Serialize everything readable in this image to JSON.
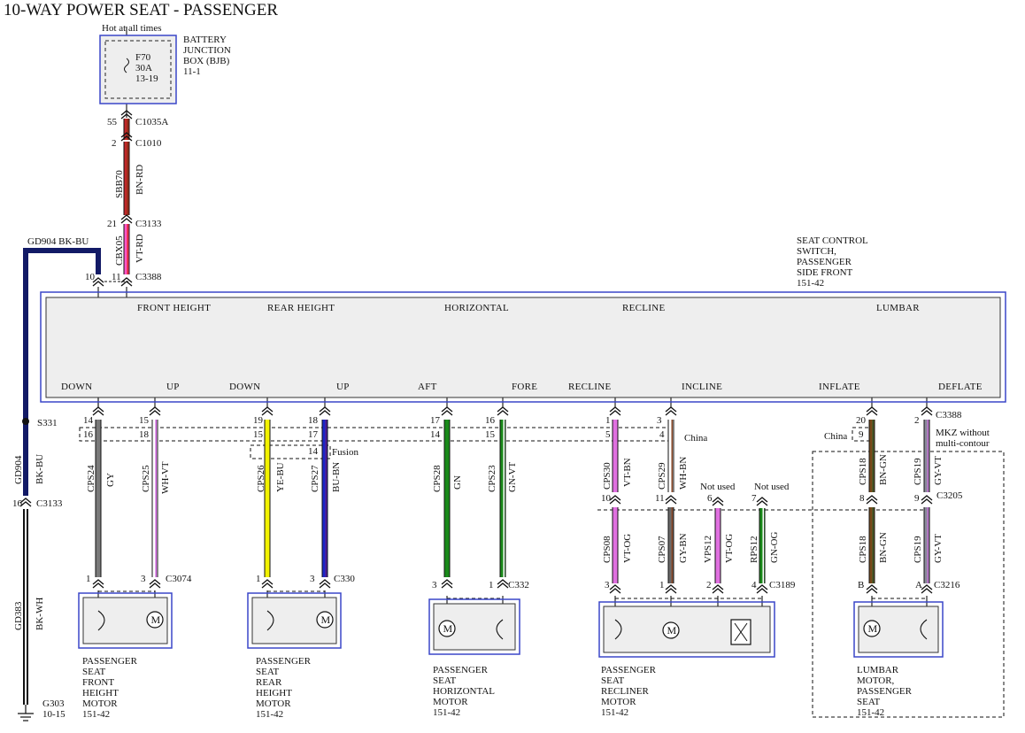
{
  "title": "10-WAY POWER SEAT - PASSENGER",
  "battery": {
    "hot": "Hot at all times",
    "name_lines": [
      "BATTERY",
      "JUNCTION",
      "BOX (BJB)",
      "11-1"
    ],
    "fuse_lines": [
      "F70",
      "30A",
      "13-19"
    ]
  },
  "feed": {
    "c1035a_pin": "55",
    "c1035a": "C1035A",
    "c1010_pin": "2",
    "c1010": "C1010",
    "sbb70_circuit": "SBB70",
    "sbb70_color": "BN-RD",
    "c3133_pin": "21",
    "c3133": "C3133",
    "cbx05_circuit": "CBX05",
    "cbx05_color": "VT-RD",
    "c3388_pin": "11",
    "c3388": "C3388"
  },
  "ground": {
    "gd904_label": "GD904  BK-BU",
    "gd904_circuit": "GD904",
    "gd904_color": "BK-BU",
    "switch_pin": "10",
    "s331": "S331",
    "c3133_pin": "16",
    "c3133": "C3133",
    "gd383_circuit": "GD383",
    "gd383_color": "BK-WH",
    "g303_lines": [
      "G303",
      "10-15"
    ]
  },
  "switch": {
    "name_lines": [
      "SEAT CONTROL",
      "SWITCH,",
      "PASSENGER",
      "SIDE FRONT",
      "151-42"
    ],
    "functions": [
      "FRONT HEIGHT",
      "REAR HEIGHT",
      "HORIZONTAL",
      "RECLINE",
      "LUMBAR"
    ],
    "positions": [
      "DOWN",
      "UP",
      "DOWN",
      "UP",
      "AFT",
      "FORE",
      "RECLINE",
      "INCLINE",
      "INFLATE",
      "DEFLATE"
    ],
    "connector": "C3388"
  },
  "wires": [
    {
      "pin": "14",
      "alt_pin": "16",
      "circuit": "CPS24",
      "color": "GY",
      "mpin": "1"
    },
    {
      "pin": "15",
      "alt_pin": "18",
      "circuit": "CPS25",
      "color": "WH-VT",
      "mpin": "3"
    },
    {
      "pin": "19",
      "alt_pin": "15",
      "circuit": "CPS26",
      "color": "YE-BU",
      "mpin": "1"
    },
    {
      "pin": "18",
      "alt_pin": "17",
      "fusion_pin": "14",
      "circuit": "CPS27",
      "color": "BU-BN",
      "mpin": "3"
    },
    {
      "pin": "17",
      "alt_pin": "14",
      "circuit": "CPS28",
      "color": "GN",
      "mpin": "3"
    },
    {
      "pin": "16",
      "alt_pin": "15",
      "circuit": "CPS23",
      "color": "GN-VT",
      "mpin": "1"
    },
    {
      "pin": "1",
      "alt_pin": "5",
      "circuit": "CPS30",
      "color": "VT-BN",
      "mid_pin": "10",
      "circuit2": "CPS08",
      "color2": "VT-OG",
      "mpin": "3"
    },
    {
      "pin": "3",
      "alt_pin": "4",
      "circuit": "CPS29",
      "color": "WH-BN",
      "mid_pin": "11",
      "circuit2": "CPS07",
      "color2": "GY-BN",
      "mpin": "1"
    },
    {
      "pin": "20",
      "alt_pin": "9",
      "circuit": "CPS18",
      "color": "BN-GN",
      "mid_pin": "8",
      "circuit2": "CPS18",
      "color2": "BN-GN",
      "mpin": "B"
    },
    {
      "pin": "2",
      "circuit": "CPS19",
      "color": "GY-VT",
      "mid_pin": "9",
      "circuit2": "CPS19",
      "color2": "GY-VT",
      "mpin": "A"
    }
  ],
  "recliner_extra": [
    {
      "label": "Not used",
      "pin": "6",
      "circuit": "VPS12",
      "color": "VT-OG",
      "mpin": "2"
    },
    {
      "label": "Not used",
      "pin": "7",
      "circuit": "RPS12",
      "color": "GN-OG",
      "mpin": "4"
    }
  ],
  "notes": {
    "china": "China",
    "fusion": "Fusion",
    "mkz": "MKZ without",
    "mkz2": "multi-contour",
    "c3205": "C3205"
  },
  "motor_connectors": [
    "C3074",
    "C330",
    "C332",
    "C3189",
    "C3216"
  ],
  "motors": [
    [
      "PASSENGER",
      "SEAT",
      "FRONT",
      "HEIGHT",
      "MOTOR",
      "151-42"
    ],
    [
      "PASSENGER",
      "SEAT",
      "REAR",
      "HEIGHT",
      "MOTOR",
      "151-42"
    ],
    [
      "PASSENGER",
      "SEAT",
      "HORIZONTAL",
      "MOTOR",
      "151-42"
    ],
    [
      "PASSENGER",
      "SEAT",
      "RECLINER",
      "MOTOR",
      "151-42"
    ],
    [
      "LUMBAR",
      "MOTOR,",
      "PASSENGER",
      "SEAT",
      "151-42"
    ]
  ],
  "motor_symbol": "M",
  "colors": {
    "BN-RD": [
      "#c0282a",
      "#8b2e14"
    ],
    "VT-RD": [
      "#ff55c8",
      "#e0282a"
    ],
    "BK-BU": [
      "#121a66",
      "#121a66"
    ],
    "BK-WH": [
      "#111111",
      "#ffffff"
    ],
    "GY": [
      "#7a7a7a",
      "#7a7a7a"
    ],
    "WH-VT": [
      "#ffffff",
      "#c55ad6"
    ],
    "YE-BU": [
      "#f2f200",
      "#f2f200"
    ],
    "BU-BN": [
      "#1c28c8",
      "#5a1a8a"
    ],
    "GN": [
      "#1a8a1a",
      "#1a8a1a"
    ],
    "GN-VT": [
      "#1a8a1a",
      "#ffffff"
    ],
    "VT-BN": [
      "#e070e0",
      "#e070e0"
    ],
    "WH-BN": [
      "#ffffff",
      "#8b4a2a"
    ],
    "VT-OG": [
      "#e070e0",
      "#e070e0"
    ],
    "GY-BN": [
      "#6a6a6a",
      "#8b4a2a"
    ],
    "GN-OG": [
      "#1a8a1a",
      "#ffffff"
    ],
    "BN-GN": [
      "#7a4a1a",
      "#3a5a2a"
    ],
    "GY-VT": [
      "#8a8a9a",
      "#c070d0"
    ],
    "frame": "#3a46c8",
    "panel": "#eeeeee"
  }
}
